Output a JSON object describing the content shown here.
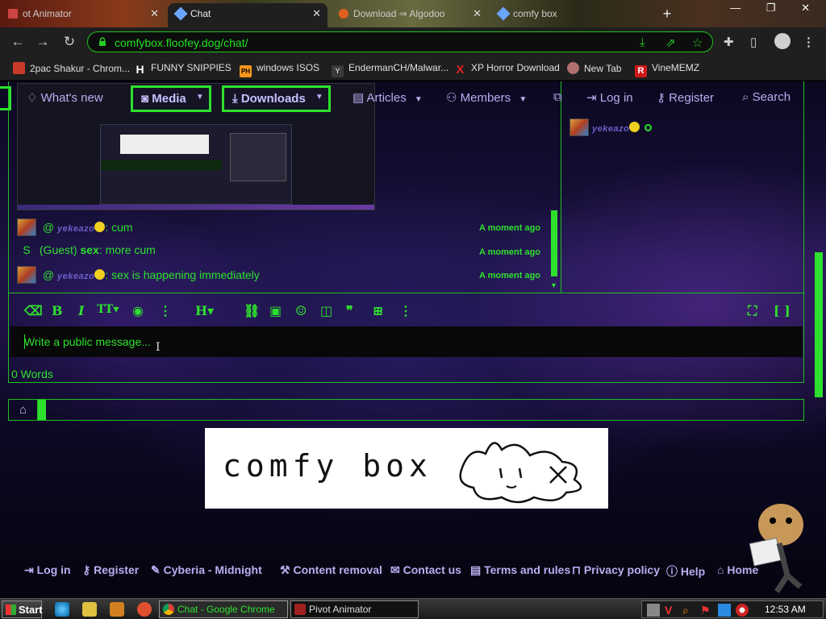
{
  "browser": {
    "tabs": [
      {
        "title": "ot Animator"
      },
      {
        "title": "Chat",
        "active": true
      },
      {
        "title": "Download ⇒ Algodoo"
      },
      {
        "title": "comfy box"
      }
    ],
    "window_controls": "— ❐ ✕",
    "url": "comfybox.floofey.dog/chat/",
    "bookmarks": [
      {
        "label": "2pac Shakur - Chrom...",
        "color": "#c83a2a"
      },
      {
        "label": "FUNNY SNIPPIES",
        "icon_text": "H",
        "color": "#ffffff"
      },
      {
        "label": "windows ISOS",
        "icon_text": "PH",
        "color": "#f7971d"
      },
      {
        "label": "EndermanCH/Malwar...",
        "icon_text": "Y",
        "color": "#3a3a3a"
      },
      {
        "label": "XP Horror Download",
        "icon_text": "X",
        "color": "#e02020"
      },
      {
        "label": "New Tab",
        "color": "#b07070"
      },
      {
        "label": "VineMEMZ",
        "icon_text": "R",
        "color": "#d01818"
      }
    ]
  },
  "nav": {
    "whats_new": "What's new",
    "media": "Media",
    "downloads": "Downloads",
    "articles": "Articles",
    "members": "Members",
    "log_in": "Log in",
    "register": "Register",
    "search": "Search"
  },
  "chat": {
    "messages": [
      {
        "prefix": "@",
        "user": "yekeazo",
        "text": ": cum",
        "time": "A moment ago"
      },
      {
        "guest_initial": "S",
        "guest_label": "(Guest)",
        "user": "sex",
        "text": ": more cum",
        "time": "A moment ago"
      },
      {
        "prefix": "@",
        "user": "yekeazo",
        "text": ": sex is happening immediately",
        "time": "A moment ago"
      }
    ],
    "online_user": "yekeazo",
    "composer_placeholder": "Write a public message...",
    "word_count": "0 Words"
  },
  "editor_tools": [
    "eraser",
    "B",
    "I",
    "TT",
    "palette",
    "⋮",
    "H",
    "link",
    "image",
    "smilie",
    "media",
    "quote",
    "table",
    "⋮",
    "fullscreen",
    "brackets"
  ],
  "banner": {
    "text": "comfy box"
  },
  "footer": {
    "links": [
      "Log in",
      "Register",
      "Cyberia - Midnight",
      "Content removal",
      "Contact us",
      "Terms and rules",
      "Privacy policy",
      "Help",
      "Home"
    ]
  },
  "taskbar": {
    "start": "Start",
    "tasks": [
      {
        "label": "Chat - Google Chrome",
        "active": true
      },
      {
        "label": "Pivot Animator"
      }
    ],
    "clock": "12:53 AM"
  },
  "colors": {
    "accent_green": "#2ee02e",
    "nav_lavender": "#b8aef0",
    "username_purple": "#6b5fc8"
  }
}
